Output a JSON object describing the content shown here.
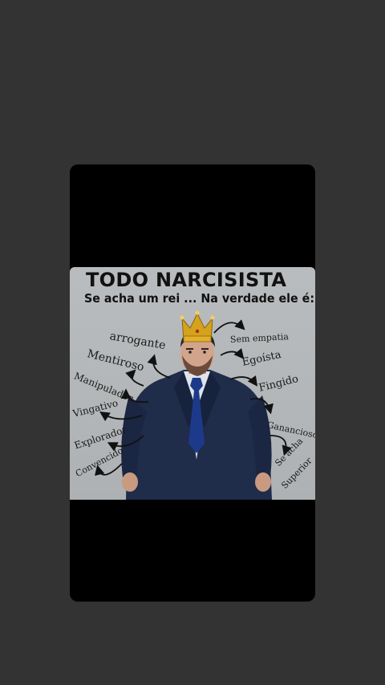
{
  "poster": {
    "title": "TODO NARCISISTA",
    "subtitle": "Se acha um rei ... Na verdade ele é:",
    "traits": {
      "arrogante": "arrogante",
      "mentiroso": "Mentiroso",
      "manipulador": "Manipulador",
      "vingativo": "Vingativo",
      "explorador": "Explorador",
      "convencido": "Convencido",
      "sem_empatia": "Sem empatia",
      "egoista": "Egoísta",
      "fingido": "Fingido",
      "ganancioso": "Ganancioso",
      "se_acha": "Se acha",
      "superior": "Superior"
    }
  },
  "icons": [
    "crown-icon",
    "arrow-icon"
  ],
  "colors": {
    "page_background": "#333333",
    "video_frame": "#000000",
    "poster_background": "#b8bbbd",
    "suit": "#1f2c4a",
    "tie": "#1d3a8a",
    "crown": "#d4a21c"
  }
}
